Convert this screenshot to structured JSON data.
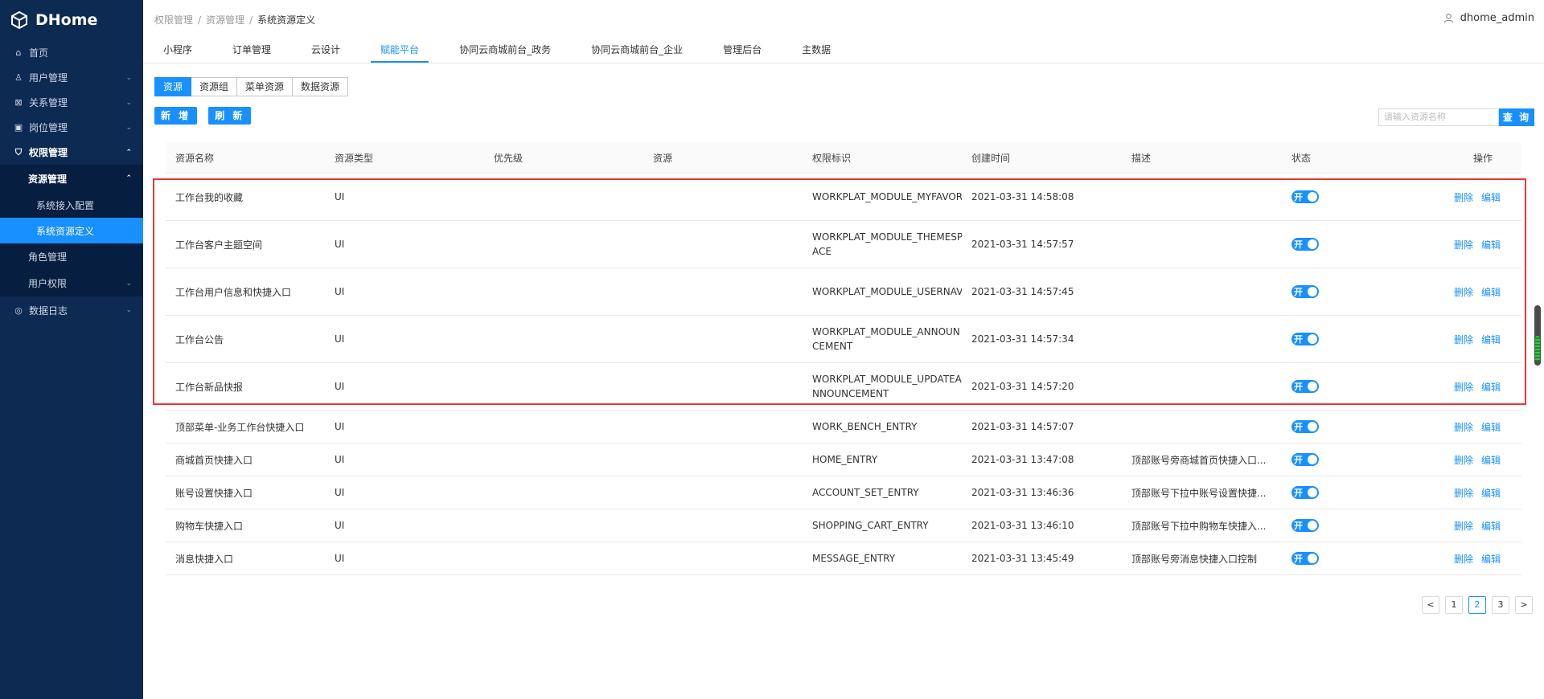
{
  "app": {
    "brand": "DHome"
  },
  "sidebar": {
    "items": [
      {
        "label": "首页"
      },
      {
        "label": "用户管理"
      },
      {
        "label": "关系管理"
      },
      {
        "label": "岗位管理"
      },
      {
        "label": "权限管理"
      },
      {
        "label": "数据日志"
      }
    ],
    "submenu": {
      "head": "资源管理",
      "items": [
        {
          "label": "系统接入配置"
        },
        {
          "label": "系统资源定义"
        }
      ],
      "plain": [
        {
          "label": "角色管理"
        },
        {
          "label": "用户权限"
        }
      ]
    }
  },
  "header": {
    "breadcrumb": [
      "权限管理",
      "资源管理",
      "系统资源定义"
    ],
    "user": "dhome_admin",
    "tabs": [
      {
        "label": "小程序"
      },
      {
        "label": "订单管理"
      },
      {
        "label": "云设计"
      },
      {
        "label": "赋能平台"
      },
      {
        "label": "协同云商城前台_政务"
      },
      {
        "label": "协同云商城前台_企业"
      },
      {
        "label": "管理后台"
      },
      {
        "label": "主数据"
      }
    ]
  },
  "toolbar": {
    "segments": [
      "资源",
      "资源组",
      "菜单资源",
      "数据资源"
    ],
    "add_label": "新 增",
    "refresh_label": "刷 新",
    "search_placeholder": "请输入资源名称",
    "search_label": "查 询"
  },
  "table": {
    "columns": [
      "资源名称",
      "资源类型",
      "优先级",
      "资源",
      "权限标识",
      "创建时间",
      "描述",
      "状态",
      "操作"
    ],
    "toggle_label": "开",
    "delete_label": "删除",
    "edit_label": "编辑",
    "rows": [
      {
        "name": "工作台我的收藏",
        "type": "UI",
        "priority": "",
        "resource": "",
        "perm": "WORKPLAT_MODULE_MYFAVOR",
        "created": "2021-03-31 14:58:08",
        "desc": ""
      },
      {
        "name": "工作台客户主题空间",
        "type": "UI",
        "priority": "",
        "resource": "",
        "perm": "WORKPLAT_MODULE_THEMESPACE",
        "created": "2021-03-31 14:57:57",
        "desc": ""
      },
      {
        "name": "工作台用户信息和快捷入口",
        "type": "UI",
        "priority": "",
        "resource": "",
        "perm": "WORKPLAT_MODULE_USERNAV",
        "created": "2021-03-31 14:57:45",
        "desc": ""
      },
      {
        "name": "工作台公告",
        "type": "UI",
        "priority": "",
        "resource": "",
        "perm": "WORKPLAT_MODULE_ANNOUNCEMENT",
        "created": "2021-03-31 14:57:34",
        "desc": ""
      },
      {
        "name": "工作台新品快报",
        "type": "UI",
        "priority": "",
        "resource": "",
        "perm": "WORKPLAT_MODULE_UPDATEANNOUNCEMENT",
        "created": "2021-03-31 14:57:20",
        "desc": ""
      },
      {
        "name": "顶部菜单-业务工作台快捷入口",
        "type": "UI",
        "priority": "",
        "resource": "",
        "perm": "WORK_BENCH_ENTRY",
        "created": "2021-03-31 14:57:07",
        "desc": ""
      },
      {
        "name": "商城首页快捷入口",
        "type": "UI",
        "priority": "",
        "resource": "",
        "perm": "HOME_ENTRY",
        "created": "2021-03-31 13:47:08",
        "desc": "顶部账号旁商城首页快捷入口..."
      },
      {
        "name": "账号设置快捷入口",
        "type": "UI",
        "priority": "",
        "resource": "",
        "perm": "ACCOUNT_SET_ENTRY",
        "created": "2021-03-31 13:46:36",
        "desc": "顶部账号下拉中账号设置快捷..."
      },
      {
        "name": "购物车快捷入口",
        "type": "UI",
        "priority": "",
        "resource": "",
        "perm": "SHOPPING_CART_ENTRY",
        "created": "2021-03-31 13:46:10",
        "desc": "顶部账号下拉中购物车快捷入..."
      },
      {
        "name": "消息快捷入口",
        "type": "UI",
        "priority": "",
        "resource": "",
        "perm": "MESSAGE_ENTRY",
        "created": "2021-03-31 13:45:49",
        "desc": "顶部账号旁消息快捷入口控制"
      }
    ]
  },
  "pagination": {
    "prev": "<",
    "pages": [
      "1",
      "2",
      "3"
    ],
    "next": ">"
  },
  "colors": {
    "sidebar_bg": "#0d2a52",
    "accent": "#1890ff",
    "highlight": "#e53935"
  }
}
